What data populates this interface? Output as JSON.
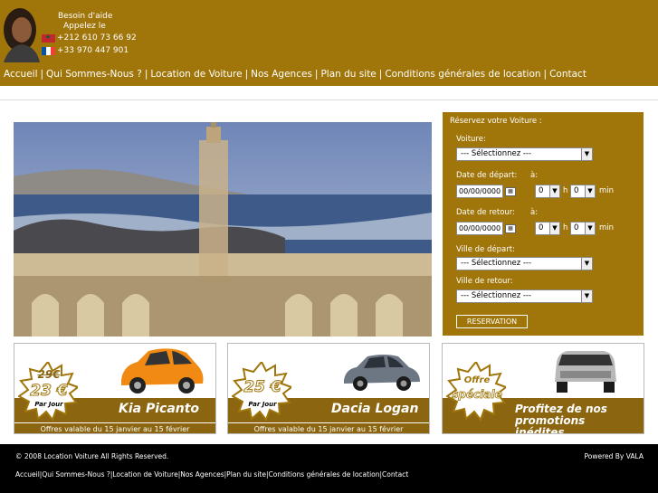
{
  "header": {
    "help_line1": "Besoin d'aide",
    "help_line2": "Appelez le",
    "phone_ma": "+212 610 73 66 92",
    "phone_fr": "+33 970 447 901"
  },
  "nav": [
    "Accueil",
    "Qui Sommes-Nous ?",
    "Location de Voiture",
    "Nos Agences",
    "Plan du site",
    "Conditions générales de location",
    "Contact"
  ],
  "booking": {
    "title": "Réservez votre Voiture :",
    "car_label": "Voiture:",
    "car_value": "--- Sélectionnez ---",
    "depart_date_label": "Date de départ:",
    "return_date_label": "Date de retour:",
    "at_label": "à:",
    "date_value": "00/00/0000",
    "hour_value": "0",
    "min_value": "0",
    "h_label": "h",
    "min_label": "min",
    "depart_city_label": "Ville de départ:",
    "depart_city_value": "--- Sélectionnez ---",
    "return_city_label": "Ville de retour:",
    "return_city_value": "--- Sélectionnez ---",
    "submit": "RESERVATION"
  },
  "promos": [
    {
      "old_price": "29€",
      "price": "23 €",
      "unit": "Par Jour",
      "car": "Kia Picanto",
      "note": "Offres valable du 15 janvier au 15 février"
    },
    {
      "price": "25 €",
      "unit": "Par Jour",
      "car": "Dacia Logan",
      "note": "Offres valable du 15 janvier au 15 février"
    },
    {
      "offer1": "Offre",
      "offer2": "spéciale",
      "headline1": "Profitez de nos",
      "headline2": "promotions inédites..."
    }
  ],
  "footer": {
    "copyright": "© 2008 Location Voiture All Rights Reserved.",
    "powered": "Powered By VALA",
    "nav": [
      "Accueil",
      "Qui Sommes-Nous ?",
      "Location de Voiture",
      "Nos Agences",
      "Plan du site",
      "Conditions générales de location",
      "Contact"
    ]
  },
  "colors": {
    "brand": "#a0760b",
    "band": "#8b6510",
    "orange_car": "#f08a12"
  }
}
